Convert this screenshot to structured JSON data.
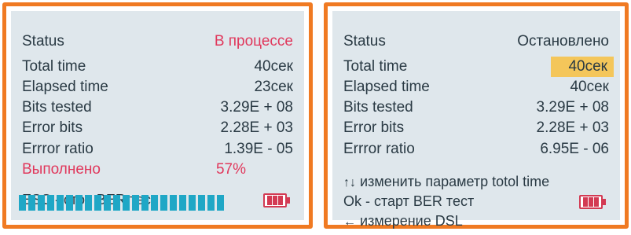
{
  "left": {
    "rows": [
      {
        "label": "Status",
        "value": "В процессе"
      },
      {
        "label": "Total time",
        "value": "40сек"
      },
      {
        "label": "Elapsed time",
        "value": "23сек"
      },
      {
        "label": "Bits tested",
        "value": "3.29E + 08"
      },
      {
        "label": "Error  bits",
        "value": "2.28E + 03"
      },
      {
        "label": "Errror ratio",
        "value": "1.39E  - 05"
      },
      {
        "label": "Выполнено",
        "value": "57%"
      }
    ],
    "hint": "ESC - стоп BER тест",
    "progress_segments": 22
  },
  "right": {
    "rows": [
      {
        "label": "Status",
        "value": "Остановлено"
      },
      {
        "label": "Total time",
        "value": "40сек"
      },
      {
        "label": "Elapsed time",
        "value": "40сек"
      },
      {
        "label": "Bits tested",
        "value": "3.29E + 08"
      },
      {
        "label": "Error  bits",
        "value": "2.28E + 03"
      },
      {
        "label": "Errror ratio",
        "value": "6.95E - 06"
      }
    ],
    "hint1_arrows": "↑↓",
    "hint1_text": "изменить параметр totol time",
    "hint2": "Ok - старт BER тест",
    "hint3_arrow": "←",
    "hint3_text": "измерение  DSL"
  },
  "colors": {
    "frame": "#f07a22",
    "screen": "#dfe7ec",
    "text": "#2a3a44",
    "alert": "#e0385c",
    "highlight": "#f4c65a",
    "progress": "#1fa7c6",
    "battery": "#d33a53"
  },
  "icons": [
    "battery-icon",
    "up-down-arrows-icon",
    "left-arrow-icon"
  ]
}
